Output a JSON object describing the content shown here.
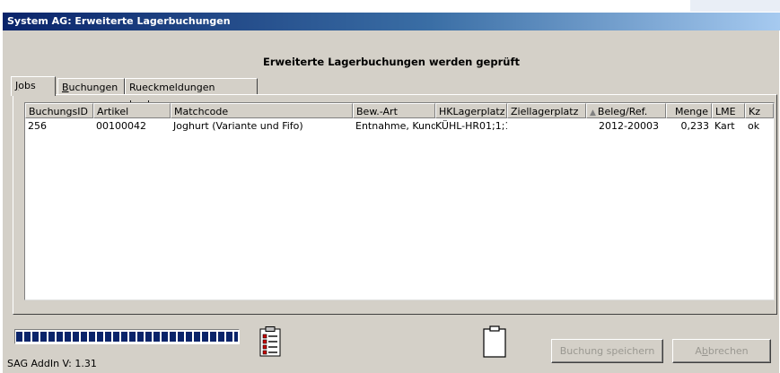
{
  "window": {
    "title": "System AG: Erweiterte Lagerbuchungen"
  },
  "heading": "Erweiterte Lagerbuchungen werden geprüft",
  "tabs": [
    {
      "label": "Jobs",
      "mnemonic": "J",
      "rest": "obs",
      "active": true
    },
    {
      "label": "Buchungen",
      "mnemonic": "B",
      "rest": "uchungen",
      "active": false
    },
    {
      "label": "Rueckmeldungen buchen",
      "active": false
    }
  ],
  "table": {
    "columns": [
      "BuchungsID",
      "Artikel",
      "Matchcode",
      "Bew.-Art",
      "HKLagerplatz",
      "Ziellagerplatz",
      "Beleg/Ref.",
      "Menge",
      "LME",
      "Kz"
    ],
    "sorted_column": "Beleg/Ref.",
    "rows": [
      {
        "BuchungsID": "256",
        "Artikel": "00100042",
        "Matchcode": "Joghurt (Variante und Fifo)",
        "BewArt": "Entnahme, Kund",
        "HKLagerplatz": "KÜHL-HR01;1;1;",
        "Ziellagerplatz": "",
        "BelegRef": "2012-20003",
        "Menge": "0,233",
        "LME": "Kart",
        "Kz": "ok"
      }
    ]
  },
  "progress": {
    "fraction": 1.0,
    "color": "#0a246a"
  },
  "icons": {
    "checklist": "checklist-icon",
    "clipboard": "clipboard-icon"
  },
  "buttons": {
    "save": {
      "label": "Buchung speichern",
      "enabled": false
    },
    "cancel": {
      "label_pre": "A",
      "label_mn": "b",
      "label_post": "brechen",
      "label": "Abbrechen",
      "enabled": false
    }
  },
  "version_text": "SAG AddIn V:  1.31"
}
